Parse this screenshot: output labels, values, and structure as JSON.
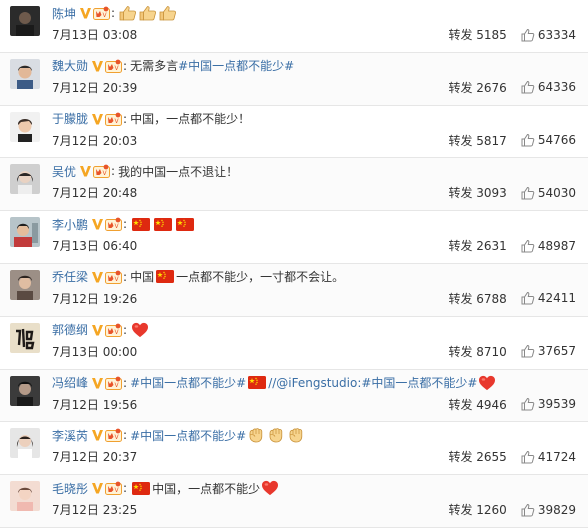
{
  "posts": [
    {
      "user": "陈坤",
      "time": "7月13日 03:08",
      "repost": "转发 5185",
      "likes": "63334",
      "content": []
    },
    {
      "user": "魏大勋",
      "time": "7月12日 20:39",
      "repost": "转发 2676",
      "likes": "64336",
      "content_text": "无需多言",
      "content_tag": "#中国一点都不能少#"
    },
    {
      "user": "于朦胧",
      "time": "7月12日 20:03",
      "repost": "转发 5817",
      "likes": "54766",
      "content_text": "中国，一点都不能少！"
    },
    {
      "user": "吴优",
      "time": "7月12日 20:48",
      "repost": "转发 3093",
      "likes": "54030",
      "content_text": "我的中国一点不退让！"
    },
    {
      "user": "李小鹏",
      "time": "7月13日 06:40",
      "repost": "转发 2631",
      "likes": "48987"
    },
    {
      "user": "乔任梁",
      "time": "7月12日 19:26",
      "repost": "转发 6788",
      "likes": "42411",
      "content_pre": "中国",
      "content_post": "一点都不能少，一寸都不会让。"
    },
    {
      "user": "郭德纲",
      "time": "7月13日 00:00",
      "repost": "转发 8710",
      "likes": "37657"
    },
    {
      "user": "冯绍峰",
      "time": "7月12日 19:56",
      "repost": "转发 4946",
      "likes": "39539",
      "content_tag": "#中国一点都不能少#",
      "content_mid": "//@iFengstudio:",
      "content_tag2": "#中国一点都不能少#"
    },
    {
      "user": "李溪芮",
      "time": "7月12日 20:37",
      "repost": "转发 2655",
      "likes": "41724",
      "content_tag": "#中国一点都不能少#"
    },
    {
      "user": "毛晓彤",
      "time": "7月12日 23:25",
      "repost": "转发 1260",
      "likes": "39829",
      "content_text": "中国，一点都不能少"
    }
  ],
  "icons": {
    "verified": "verified-v-icon",
    "vip": "vip-crown-icon",
    "like": "thumbs-up-icon",
    "flag": "china-flag-emoji",
    "heart": "heart-emoji",
    "thumbs": "thumbs-up-emoji",
    "fist": "fist-emoji"
  },
  "colors": {
    "link": "#3a6ea5",
    "verified": "#f5a623",
    "vip": "#e8542a",
    "flag": "#de2910",
    "heart": "#e8382d"
  }
}
